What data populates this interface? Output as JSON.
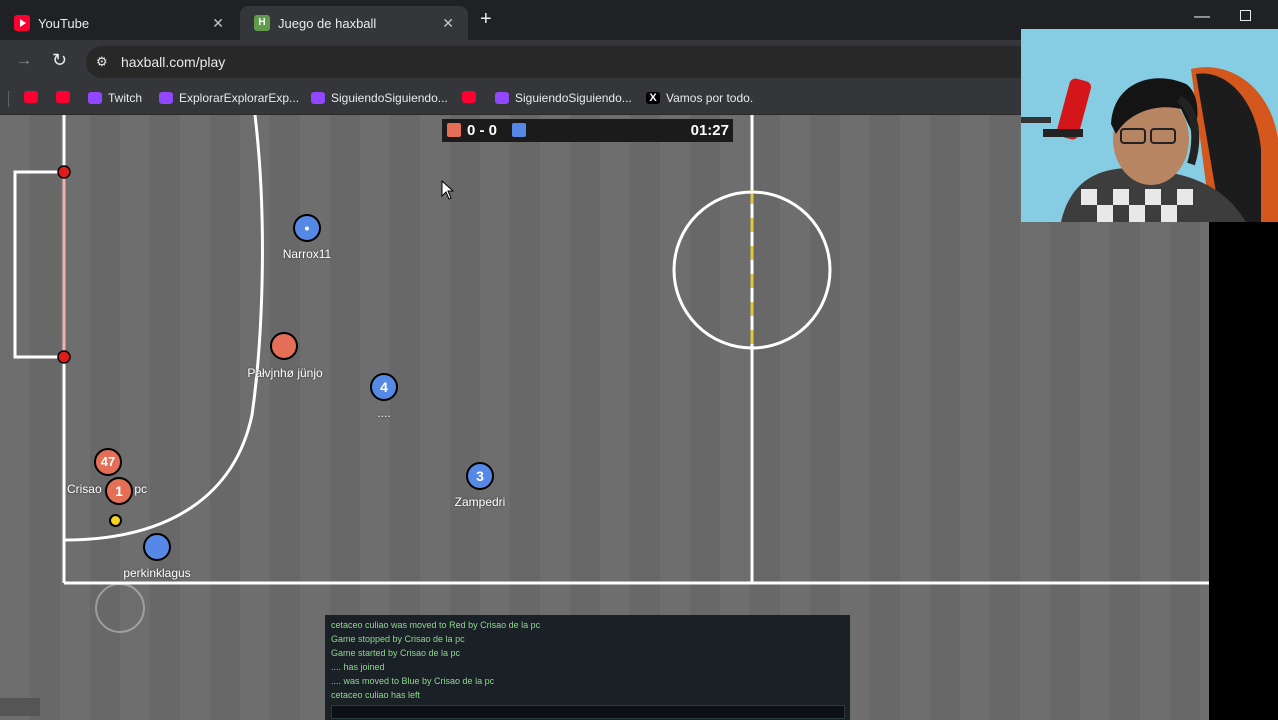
{
  "browser": {
    "tabs": [
      {
        "label": "YouTube",
        "icon": "youtube-icon"
      },
      {
        "label": "Juego de haxball",
        "icon": "haxball-icon"
      }
    ],
    "new_tab_symbol": "+",
    "url": "haxball.com/play",
    "bookmarks": [
      {
        "label": "",
        "icon": "youtube-icon"
      },
      {
        "label": "",
        "icon": "youtube-icon"
      },
      {
        "label": "Twitch",
        "icon": "twitch-icon"
      },
      {
        "label": "ExplorarExplorarExp...",
        "icon": "twitch-icon"
      },
      {
        "label": "SiguiendoSiguiendo...",
        "icon": "twitch-icon"
      },
      {
        "label": "",
        "icon": "youtube-icon"
      },
      {
        "label": "SiguiendoSiguiendo...",
        "icon": "twitch-icon"
      },
      {
        "label": "Vamos por todo.",
        "icon": "x-icon"
      }
    ]
  },
  "scoreboard": {
    "score": "0 - 0",
    "time": "01:27",
    "red_color": "#e56e56",
    "blue_color": "#5689e5"
  },
  "players": [
    {
      "team": "blue",
      "avatar": "•",
      "name": "Narrox11"
    },
    {
      "team": "red",
      "avatar": "",
      "name": "Pałvjnhø jünjo"
    },
    {
      "team": "blue",
      "avatar": "4",
      "name": "...."
    },
    {
      "team": "blue",
      "avatar": "3",
      "name": "Zampedri"
    },
    {
      "team": "red",
      "avatar": "47",
      "name": ""
    },
    {
      "team": "red",
      "avatar": "1",
      "name": "Crisao de la pc"
    },
    {
      "team": "blue",
      "avatar": "",
      "name": "perkinklagus"
    }
  ],
  "chat": {
    "messages": [
      "cetaceo culiao was moved to Red by Crisao de la pc",
      "Game stopped by Crisao de la pc",
      "Game started by Crisao de la pc",
      ".... has joined",
      ".... was moved to Blue by Crisao de la pc",
      "cetaceo culiao has left"
    ]
  },
  "colors": {
    "pitch": "#6b6b6b",
    "lines": "#ffffff",
    "chat_text": "#8fd68f"
  }
}
